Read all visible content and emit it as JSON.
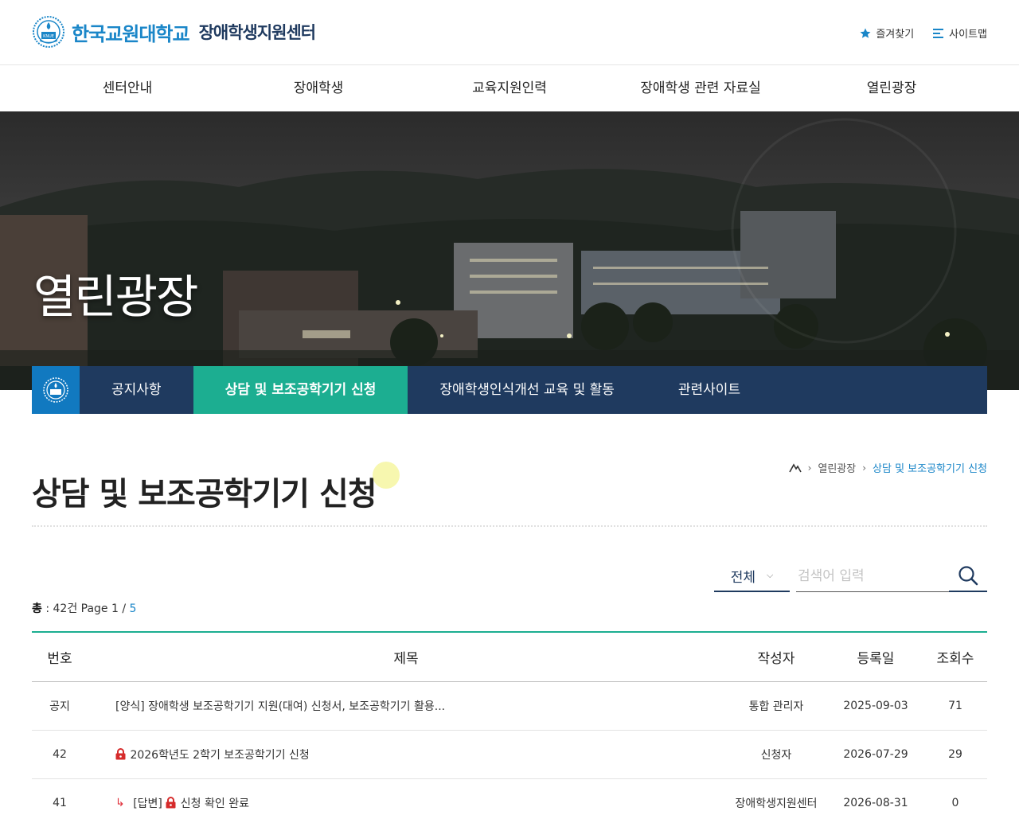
{
  "header": {
    "univ_name": "한국교원대학교",
    "center_name": "장애학생지원센터",
    "emblem_text": "KNUE",
    "util": {
      "favorites": "즐겨찾기",
      "sitemap": "사이트맵"
    }
  },
  "gnb": {
    "items": [
      {
        "label": "센터안내"
      },
      {
        "label": "장애학생"
      },
      {
        "label": "교육지원인력"
      },
      {
        "label": "장애학생 관련 자료실"
      },
      {
        "label": "열린광장"
      }
    ]
  },
  "hero": {
    "title": "열린광장"
  },
  "subnav": {
    "items": [
      {
        "label": "공지사항"
      },
      {
        "label": "상담 및 보조공학기기 신청"
      },
      {
        "label": "장애학생인식개선 교육 및 활동"
      },
      {
        "label": "관련사이트"
      }
    ]
  },
  "content": {
    "title": "상담 및 보조공학기기 신청",
    "breadcrumb": {
      "level1": "열린광장",
      "level2": "상담 및 보조공학기기 신청"
    }
  },
  "search": {
    "select_value": "전체",
    "placeholder": "검색어 입력"
  },
  "summary": {
    "total_label": "총",
    "total_value": ": 42건 Page 1 /",
    "total_pages": "5"
  },
  "table": {
    "headers": {
      "no": "번호",
      "title": "제목",
      "author": "작성자",
      "date": "등록일",
      "views": "조회수"
    },
    "rows": [
      {
        "no": "공지",
        "title": "[양식] 장애학생 보조공학기기 지원(대여) 신청서, 보조공학기기 활용...",
        "author": "통합 관리자",
        "date": "2025-09-03",
        "views": "71"
      },
      {
        "no": "42",
        "title": "2026학년도 2학기 보조공학기기 신청",
        "author": "신청자",
        "date": "2026-07-29",
        "views": "29"
      },
      {
        "no": "41",
        "reply_prefix": "[답변]",
        "title": "신청 확인 완료",
        "author": "장애학생지원센터",
        "date": "2026-08-31",
        "views": "0"
      }
    ]
  },
  "colors": {
    "brand_blue": "#1a86c8",
    "navy": "#1f3a5f",
    "green": "#1cae91"
  }
}
